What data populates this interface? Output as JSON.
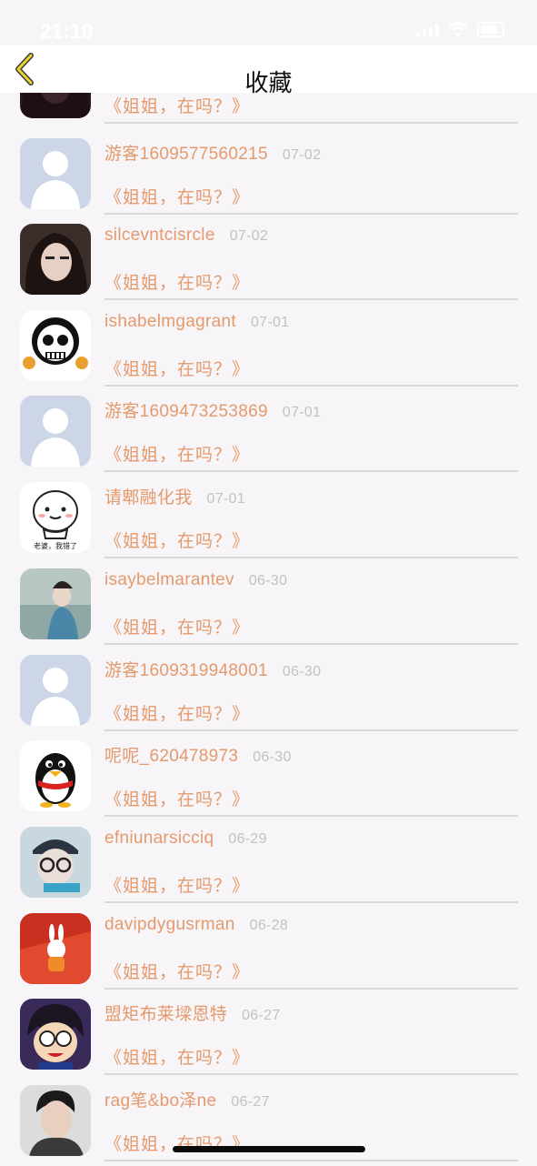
{
  "status_bar": {
    "time": "21:10",
    "icons": [
      "signal-icon",
      "wifi-icon",
      "battery-icon"
    ]
  },
  "nav": {
    "title": "收藏",
    "back_icon": "chevron-left-icon",
    "accent_color": "#e8d22c"
  },
  "colors": {
    "name": "#e49a6c",
    "message": "#e49a6c",
    "date": "#c2c2c2",
    "divider": "#d8d8d8",
    "background": "#f7f5f8"
  },
  "favorites": [
    {
      "name": "",
      "date": "",
      "message": "《姐姐，在吗？》",
      "avatar": "photo-dark-hair"
    },
    {
      "name": "游客1609577560215",
      "date": "07-02",
      "message": "《姐姐，在吗？》",
      "avatar": "default-silhouette"
    },
    {
      "name": "silcevntcisrcle",
      "date": "07-02",
      "message": "《姐姐，在吗？》",
      "avatar": "photo-girl"
    },
    {
      "name": "ishabelmgagrant",
      "date": "07-01",
      "message": "《姐姐，在吗？》",
      "avatar": "skull-cartoon"
    },
    {
      "name": "游客1609473253869",
      "date": "07-01",
      "message": "《姐姐，在吗？》",
      "avatar": "default-silhouette"
    },
    {
      "name": "请郫融化我",
      "date": "07-01",
      "message": "《姐姐，在吗？》",
      "avatar": "cute-face",
      "avatar_caption": "老婆，我错了"
    },
    {
      "name": "isaybelmarantev",
      "date": "06-30",
      "message": "《姐姐，在吗？》",
      "avatar": "photo-painting"
    },
    {
      "name": "游客1609319948001",
      "date": "06-30",
      "message": "《姐姐，在吗？》",
      "avatar": "default-silhouette"
    },
    {
      "name": "呢呢_620478973",
      "date": "06-30",
      "message": "《姐姐，在吗？》",
      "avatar": "qq-penguin"
    },
    {
      "name": "efniunarsicciq",
      "date": "06-29",
      "message": "《姐姐，在吗？》",
      "avatar": "photo-cap-glasses"
    },
    {
      "name": "davipdygusrman",
      "date": "06-28",
      "message": "《姐姐，在吗？》",
      "avatar": "photo-bunny-red"
    },
    {
      "name": "盟矩布莱墚恩特",
      "date": "06-27",
      "message": "《姐姐，在吗？》",
      "avatar": "anime-boy"
    },
    {
      "name": "rag笔&bo泽ne",
      "date": "06-27",
      "message": "《姐姐，在吗？》",
      "avatar": "photo-man"
    }
  ]
}
